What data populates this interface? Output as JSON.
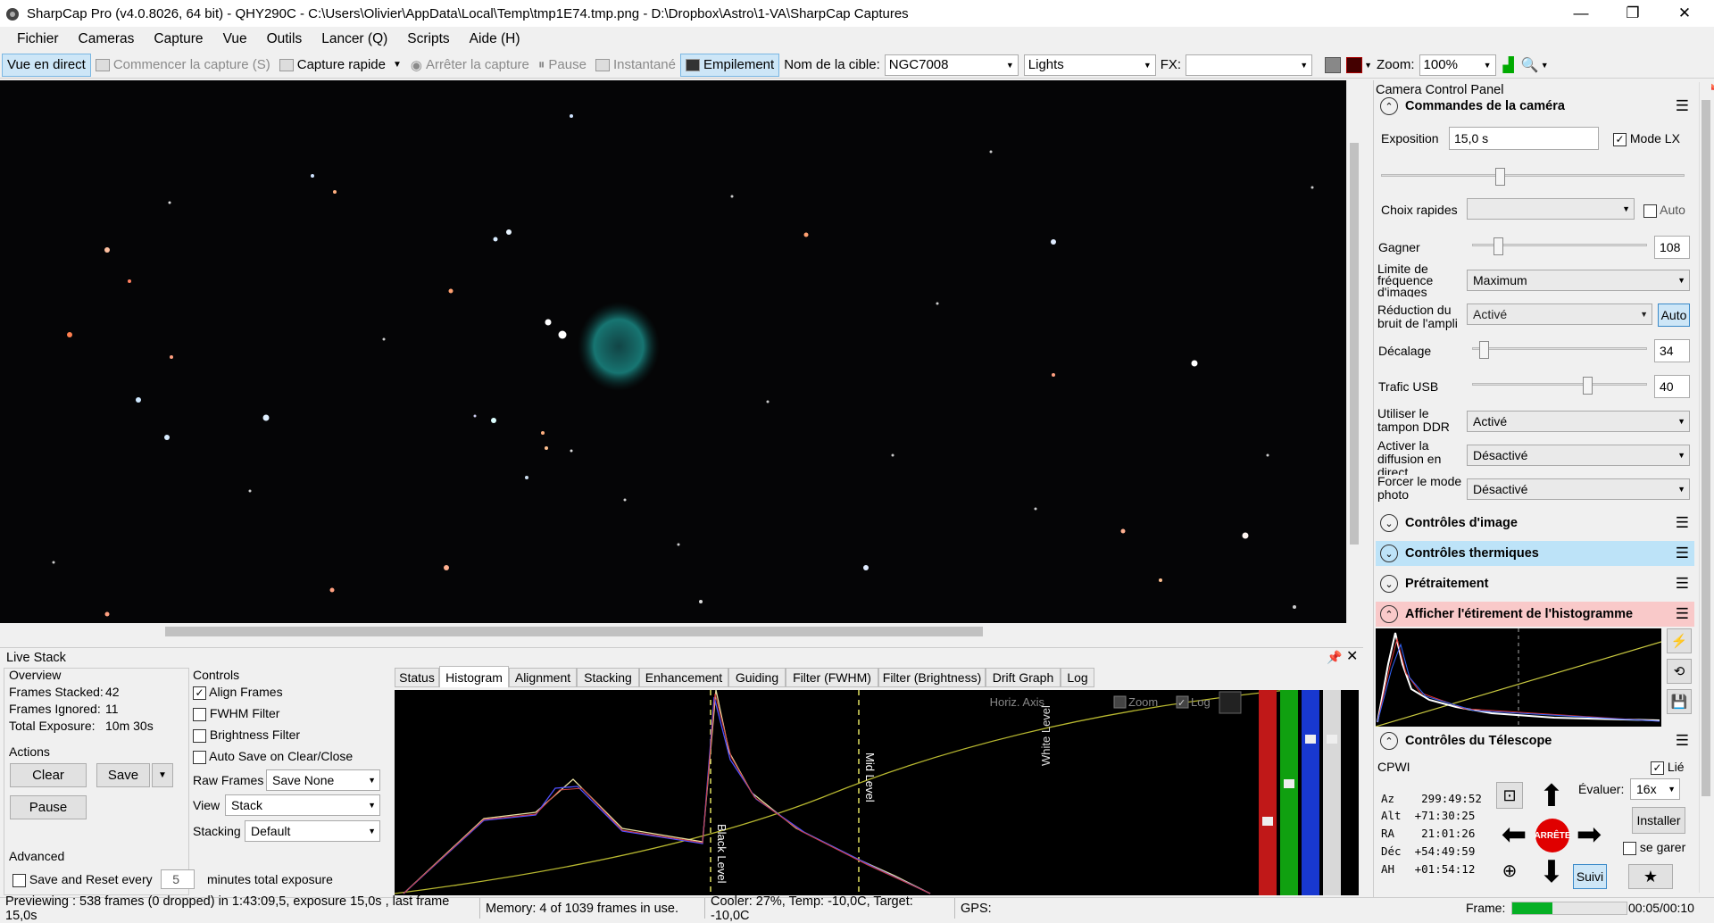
{
  "window": {
    "title": "SharpCap Pro (v4.0.8026, 64 bit) - QHY290C - C:\\Users\\Olivier\\AppData\\Local\\Temp\\tmp1E74.tmp.png - D:\\Dropbox\\Astro\\1-VA\\SharpCap Captures",
    "minimize": "—",
    "restore": "❐",
    "close": "✕"
  },
  "menu": [
    "Fichier",
    "Cameras",
    "Capture",
    "Vue",
    "Outils",
    "Lancer (Q)",
    "Scripts",
    "Aide (H)"
  ],
  "toolbar": {
    "live": "Vue en direct",
    "start_capture": "Commencer la capture (S)",
    "quick_capture": "Capture rapide",
    "stop_capture": "Arrêter la capture",
    "pause": "Pause",
    "snapshot": "Instantané",
    "stacking": "Empilement",
    "target_label": "Nom de la cible:",
    "target_value": "NGC7008",
    "frame_type": "Lights",
    "fx_label": "FX:",
    "fx_value": "",
    "zoom_label": "Zoom:",
    "zoom_value": "100%"
  },
  "ccp": {
    "title": "Camera Control Panel",
    "cam_controls": "Commandes de la caméra",
    "exposure_label": "Exposition",
    "exposure_value": "15,0 s",
    "lx_mode": "Mode LX",
    "lx_checked": "✓",
    "quick_choice": "Choix rapides",
    "auto": "Auto",
    "gain_label": "Gagner",
    "gain_value": "108",
    "fps_limit": "Limite de fréquence d'images",
    "fps_value": "Maximum",
    "amp_noise": "Réduction du bruit de l'ampli",
    "amp_value": "Activé",
    "amp_auto": "Auto",
    "offset_label": "Décalage",
    "offset_value": "34",
    "usb_label": "Trafic USB",
    "usb_value": "40",
    "ddr_label": "Utiliser le tampon DDR",
    "ddr_value": "Activé",
    "stream_label": "Activer la diffusion en direct",
    "stream_value": "Désactivé",
    "photo_label": "Forcer le mode photo",
    "photo_value": "Désactivé",
    "image_controls": "Contrôles d'image",
    "thermal_controls": "Contrôles thermiques",
    "preprocessing": "Prétraitement",
    "histo_stretch": "Afficher l'étirement de l'histogramme",
    "telescope": "Contrôles du Télescope",
    "tel_name": "CPWI",
    "linked": "Lié",
    "linked_checked": "✓",
    "az": "Az    299:49:52",
    "alt": "Alt  +71:30:25",
    "ra": "RA    21:01:26",
    "dec": "Déc  +54:49:59",
    "ah": "AH   +01:54:12",
    "rate_label": "Évaluer:",
    "rate_value": "16x",
    "stop_text": "ARRÊTE",
    "install": "Installer",
    "park": "se garer",
    "track": "Suivi"
  },
  "livestack": {
    "title": "Live Stack",
    "overview": "Overview",
    "frames_stacked_label": "Frames Stacked:",
    "frames_stacked": "42",
    "frames_ignored_label": "Frames Ignored:",
    "frames_ignored": "11",
    "total_exposure_label": "Total Exposure:",
    "total_exposure": "10m 30s",
    "actions": "Actions",
    "clear": "Clear",
    "save": "Save",
    "pause": "Pause",
    "advanced": "Advanced",
    "save_reset": "Save and Reset every",
    "reset_minutes": "5",
    "minutes_total": "minutes total exposure",
    "controls": "Controls",
    "align": "Align Frames",
    "align_checked": "✓",
    "fwhm": "FWHM Filter",
    "brightness": "Brightness Filter",
    "autosave": "Auto Save on Clear/Close",
    "raw_frames_label": "Raw Frames",
    "raw_frames": "Save None",
    "view_label": "View",
    "view": "Stack",
    "stacking_label": "Stacking",
    "stacking": "Default",
    "tabs": [
      "Status",
      "Histogram",
      "Alignment",
      "Stacking",
      "Enhancement",
      "Guiding",
      "Filter (FWHM)",
      "Filter (Brightness)",
      "Drift Graph",
      "Log"
    ],
    "horiz_axis": "Horiz. Axis",
    "zoom": "Zoom",
    "log": "Log",
    "log_checked": "✓",
    "black_level": "Black Level",
    "mid_level": "Mid Level",
    "white_level": "White Level"
  },
  "status": {
    "preview": "Previewing : 538 frames (0 dropped) in 1:43:09,5, exposure 15,0s , last frame 15,0s",
    "memory": "Memory: 4 of 1039 frames in use.",
    "cooler": "Cooler: 27%, Temp: -10,0C, Target: -10,0C",
    "gps": "GPS:",
    "frame_label": "Frame:",
    "frame_time": "00:05/00:10",
    "frame_progress": 0.35
  },
  "colors": {
    "nebula": "#1fa5a0",
    "selected": "#cde6f7",
    "thermal_header": "#bde3f8",
    "histo_header": "#f9c9c9",
    "stop": "#e00000"
  }
}
